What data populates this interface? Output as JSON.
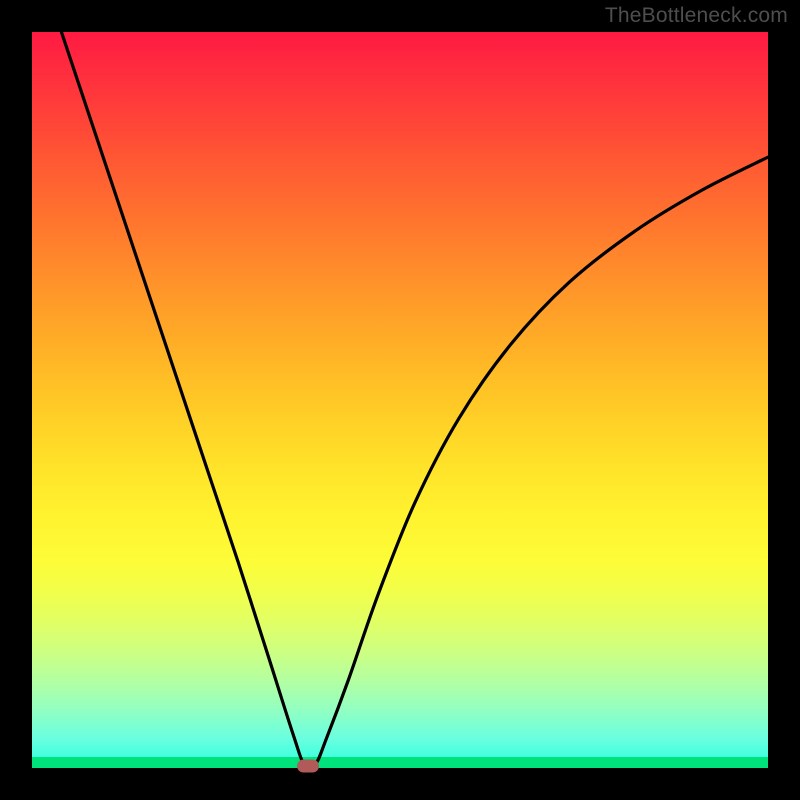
{
  "watermark": "TheBottleneck.com",
  "chart_data": {
    "type": "line",
    "title": "",
    "xlabel": "",
    "ylabel": "",
    "xlim": [
      0,
      1
    ],
    "ylim": [
      0,
      1
    ],
    "background_gradient": {
      "top_color": "#ff1a42",
      "mid_color": "#ffe52a",
      "bottom_color": "#00e27b"
    },
    "series": [
      {
        "name": "bottleneck-curve",
        "x": [
          0.04,
          0.08,
          0.12,
          0.16,
          0.2,
          0.24,
          0.28,
          0.32,
          0.355,
          0.37,
          0.385,
          0.4,
          0.43,
          0.47,
          0.52,
          0.58,
          0.65,
          0.73,
          0.82,
          0.91,
          1.0
        ],
        "y": [
          1.0,
          0.88,
          0.76,
          0.64,
          0.52,
          0.4,
          0.28,
          0.155,
          0.045,
          0.005,
          0.005,
          0.04,
          0.12,
          0.235,
          0.36,
          0.475,
          0.575,
          0.66,
          0.73,
          0.785,
          0.83
        ]
      }
    ],
    "marker": {
      "name": "optimal-point",
      "x": 0.375,
      "y": 0.003,
      "color": "#b15a5a"
    }
  }
}
